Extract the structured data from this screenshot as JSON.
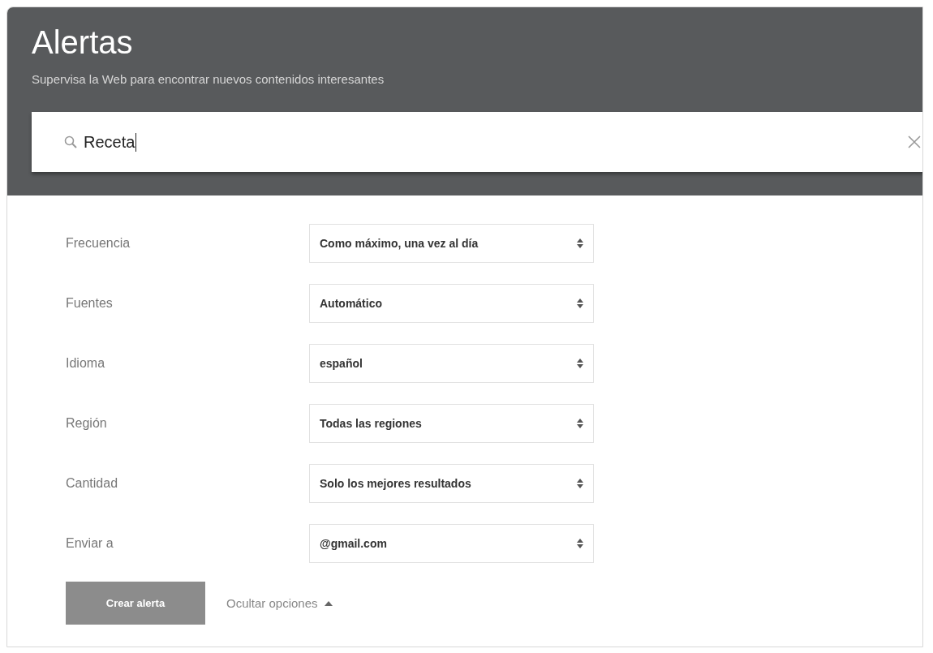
{
  "header": {
    "title": "Alertas",
    "subtitle": "Supervisa la Web para encontrar nuevos contenidos interesantes"
  },
  "search": {
    "value": "Receta"
  },
  "options": [
    {
      "label": "Frecuencia",
      "value": "Como máximo, una vez al día"
    },
    {
      "label": "Fuentes",
      "value": "Automático"
    },
    {
      "label": "Idioma",
      "value": "español"
    },
    {
      "label": "Región",
      "value": "Todas las regiones"
    },
    {
      "label": "Cantidad",
      "value": "Solo los mejores resultados"
    },
    {
      "label": "Enviar a",
      "value": "@gmail.com"
    }
  ],
  "create_button": "Crear alerta",
  "toggle_options": {
    "label": "Ocultar opciones",
    "expanded": true
  }
}
